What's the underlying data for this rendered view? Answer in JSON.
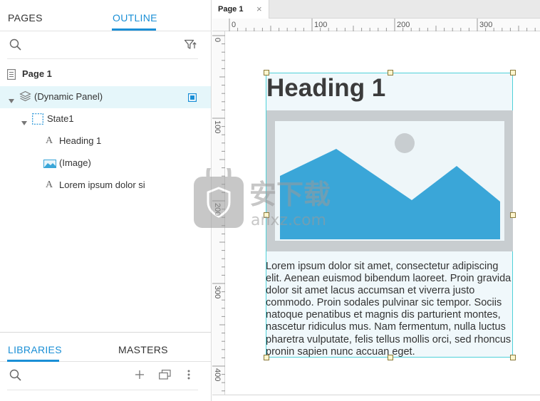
{
  "left_panel": {
    "tabs": [
      {
        "label": "PAGES",
        "active": false
      },
      {
        "label": "OUTLINE",
        "active": true
      }
    ],
    "search_icon": "search-icon",
    "filter_icon": "filter-icon",
    "tree": [
      {
        "label": "Page 1",
        "icon": "page-icon",
        "level": 0,
        "bold": true
      },
      {
        "label": "(Dynamic Panel)",
        "icon": "layers-icon",
        "level": 0,
        "expanded": true,
        "selected": true
      },
      {
        "label": "State1",
        "icon": "state-icon",
        "level": 1,
        "expanded": true
      },
      {
        "label": "Heading 1",
        "icon": "text-icon",
        "level": 2
      },
      {
        "label": "(Image)",
        "icon": "image-icon",
        "level": 2
      },
      {
        "label": "Lorem ipsum dolor si",
        "icon": "text-icon",
        "level": 2
      }
    ],
    "bottom_tabs": [
      {
        "label": "LIBRARIES",
        "active": true
      },
      {
        "label": "MASTERS",
        "active": false
      }
    ],
    "bottom_toolbar": [
      "search-icon",
      "add-icon",
      "duplicate-icon",
      "more-icon"
    ]
  },
  "document": {
    "tab_label": "Page 1",
    "close_glyph": "×"
  },
  "rulers": {
    "horizontal": [
      "0",
      "100",
      "200",
      "300"
    ],
    "vertical": [
      "0",
      "100",
      "200",
      "300",
      "400"
    ]
  },
  "canvas": {
    "heading": "Heading 1",
    "lorem": "Lorem ipsum dolor sit amet, consectetur adipiscing elit. Aenean euismod bibendum laoreet. Proin gravida dolor sit amet lacus accumsan et viverra justo commodo. Proin sodales pulvinar sic tempor. Sociis natoque penatibus et magnis dis parturient montes, nascetur ridiculus mus. Nam fermentum, nulla luctus pharetra vulputate, felis tellus mollis orci, sed rhoncus pronin sapien nunc accuan eget."
  },
  "watermark": {
    "text": "安下载",
    "sub": "anxz.com"
  },
  "colors": {
    "accent": "#1a8fd6",
    "selection_bg": "#e5f6fa",
    "selection_border": "#4fd1d9",
    "image_blue": "#3aa6d8",
    "image_frame": "#c8cdd0"
  }
}
